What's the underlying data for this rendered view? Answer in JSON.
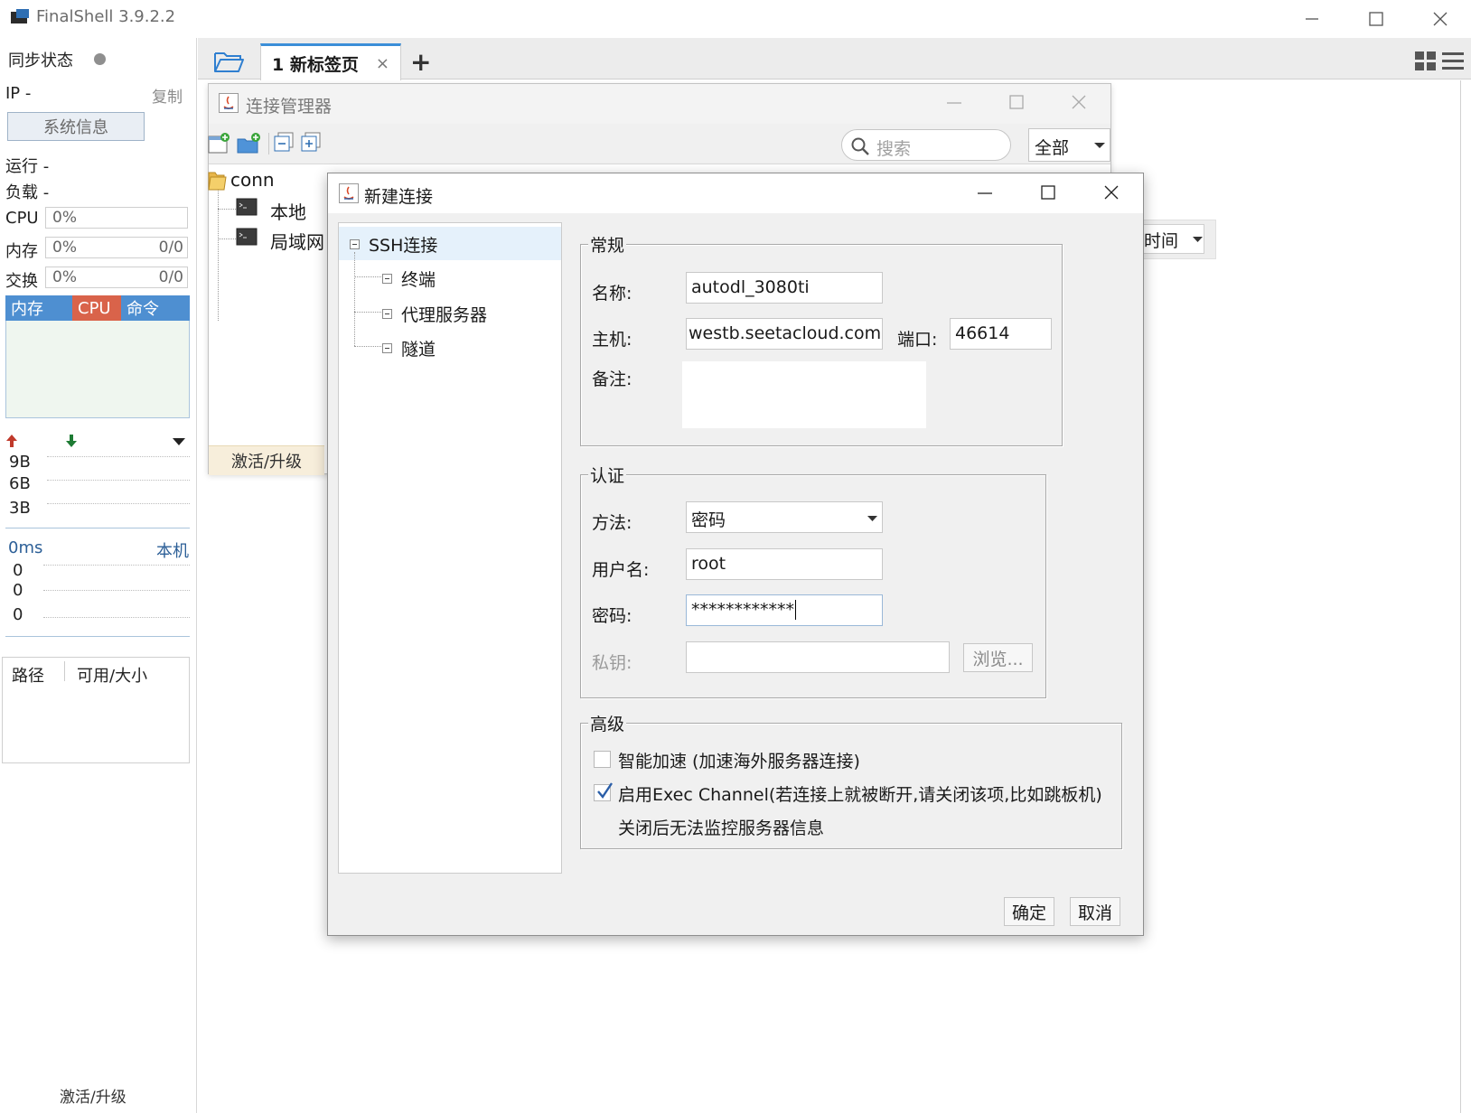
{
  "app": {
    "title": "FinalShell 3.9.2.2"
  },
  "sidebar": {
    "sync_label": "同步状态",
    "ip_label": "IP  -",
    "copy_label": "复制",
    "sysinfo_button": "系统信息",
    "run_label": "运行 -",
    "load_label": "负载 -",
    "cpu": {
      "label": "CPU",
      "value": "0%"
    },
    "mem": {
      "label": "内存",
      "value": "0%",
      "extra": "0/0"
    },
    "swap": {
      "label": "交换",
      "value": "0%",
      "extra": "0/0"
    },
    "stat_tabs": [
      "内存",
      "CPU",
      "命令"
    ],
    "net": {
      "ticks": [
        "9B",
        "6B",
        "3B"
      ]
    },
    "ping": {
      "label": "0ms",
      "host": "本机",
      "ticks": [
        "0",
        "0",
        "0"
      ]
    },
    "disk_headers": [
      "路径",
      "可用/大小"
    ],
    "activate": "激活/升级"
  },
  "tabs": {
    "active": "1 新标签页",
    "close": "×",
    "add": "+"
  },
  "conn_manager": {
    "title": "连接管理器",
    "search_placeholder": "搜索",
    "filter": "全部",
    "tree": {
      "root": "conn",
      "items": [
        "本地",
        "局域网"
      ]
    },
    "time_column": "时间",
    "activate": "激活/升级"
  },
  "dialog": {
    "title": "新建连接",
    "tree": {
      "root": "SSH连接",
      "children": [
        "终端",
        "代理服务器",
        "隧道"
      ]
    },
    "general": {
      "legend": "常规",
      "name_label": "名称:",
      "name_value": "autodl_3080ti",
      "host_label": "主机:",
      "host_value": "westb.seetacloud.com",
      "port_label": "端口:",
      "port_value": "46614",
      "note_label": "备注:"
    },
    "auth": {
      "legend": "认证",
      "method_label": "方法:",
      "method_value": "密码",
      "user_label": "用户名:",
      "user_value": "root",
      "password_label": "密码:",
      "password_value": "************",
      "key_label": "私钥:",
      "browse_button": "浏览..."
    },
    "advanced": {
      "legend": "高级",
      "accel_label": "智能加速 (加速海外服务器连接)",
      "accel_checked": false,
      "exec_label": "启用Exec Channel(若连接上就被断开,请关闭该项,比如跳板机)",
      "exec_checked": true,
      "exec_note": "关闭后无法监控服务器信息"
    },
    "ok_button": "确定",
    "cancel_button": "取消"
  },
  "colors": {
    "accent": "#3b8ed8",
    "cpu_tab": "#d9634a",
    "mem_tab": "#4e8fd1"
  }
}
